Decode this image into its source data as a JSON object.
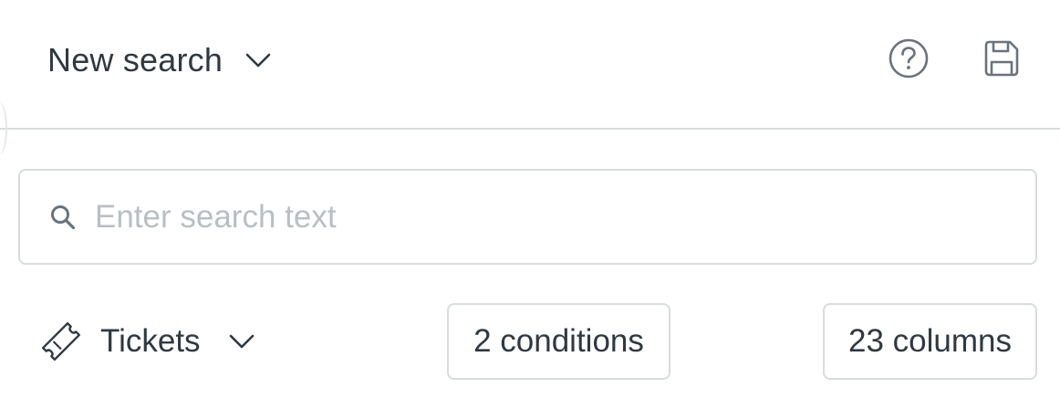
{
  "header": {
    "title": "New search",
    "icons": {
      "dropdown": "chevron-down-icon",
      "help": "help-circle-icon",
      "save": "save-icon"
    }
  },
  "search": {
    "placeholder": "Enter search text",
    "value": "",
    "icon": "search-icon"
  },
  "filters": {
    "type_label": "Tickets",
    "type_icon": "ticket-icon",
    "conditions_label": "2 conditions",
    "columns_label": "23 columns"
  },
  "colors": {
    "text": "#2f3941",
    "border": "#d8dcde",
    "placeholder": "#b8bfc4",
    "icon": "#68737d"
  }
}
